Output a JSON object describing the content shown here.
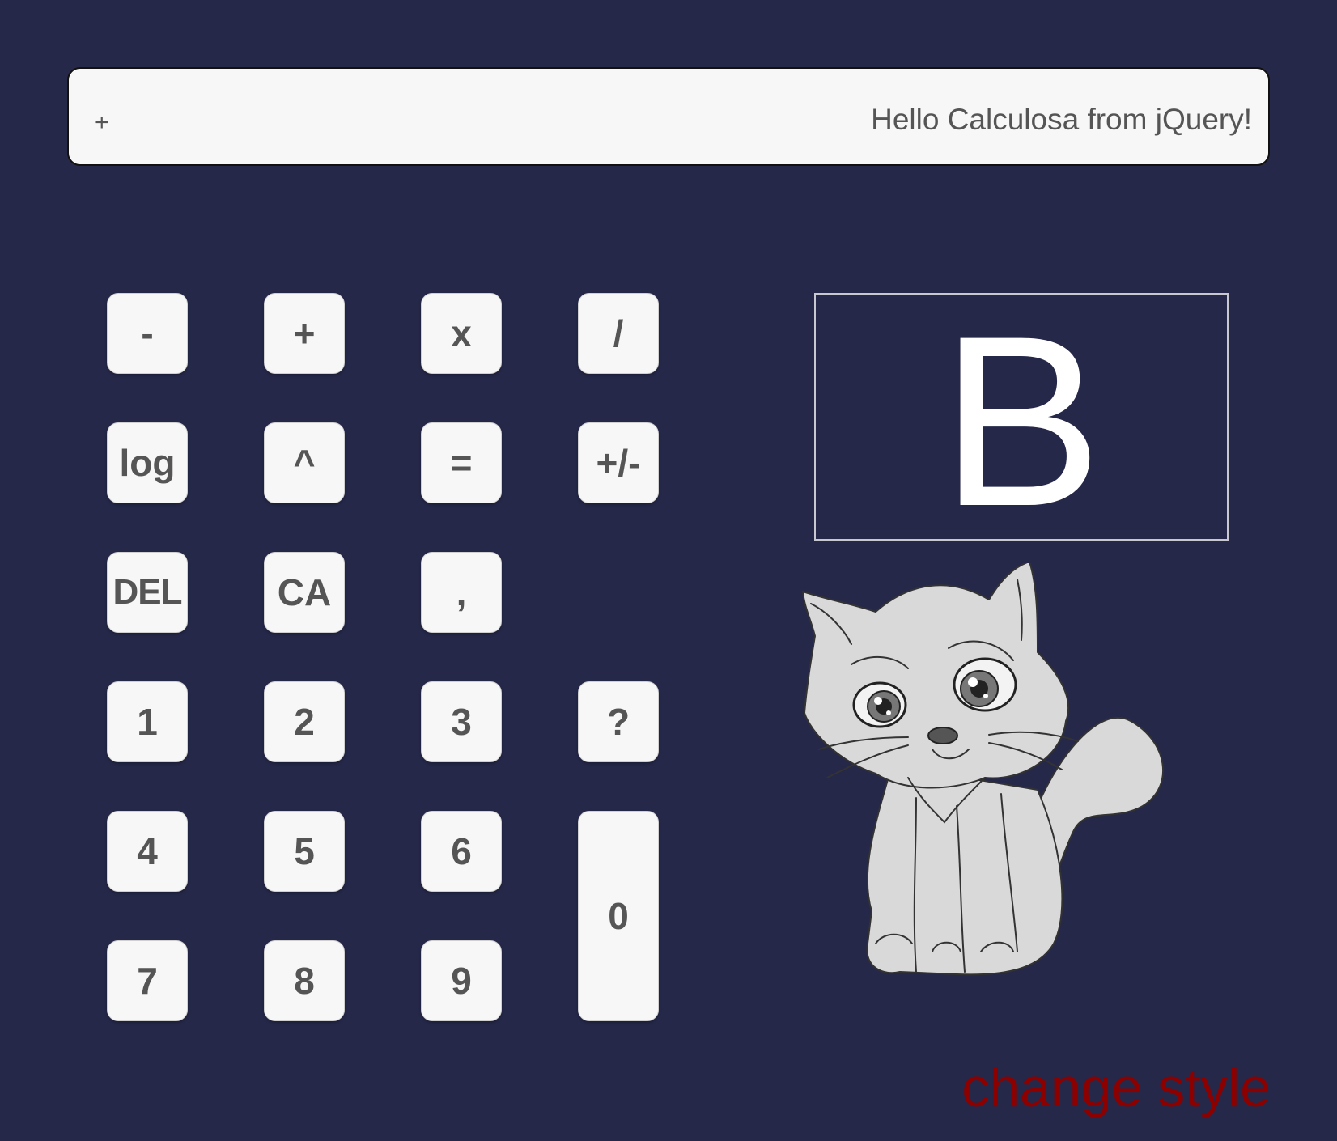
{
  "display": {
    "operator": "+",
    "value": "Hello Calculosa from jQuery!"
  },
  "keypad": {
    "minus": "-",
    "plus": "+",
    "multiply": "x",
    "divide": "/",
    "log": "log",
    "power": "^",
    "equals": "=",
    "sign": "+/-",
    "del": "DEL",
    "clear_all": "CA",
    "comma": ",",
    "one": "1",
    "two": "2",
    "three": "3",
    "question": "?",
    "four": "4",
    "five": "5",
    "six": "6",
    "zero": "0",
    "seven": "7",
    "eight": "8",
    "nine": "9"
  },
  "logo": {
    "letter": "B"
  },
  "illustration": {
    "icon": "cat-sketch"
  },
  "footer": {
    "change_style": "change style"
  },
  "colors": {
    "background": "#252849",
    "key_background": "#f7f7f7",
    "key_text": "#555555",
    "link": "#8c0000"
  }
}
